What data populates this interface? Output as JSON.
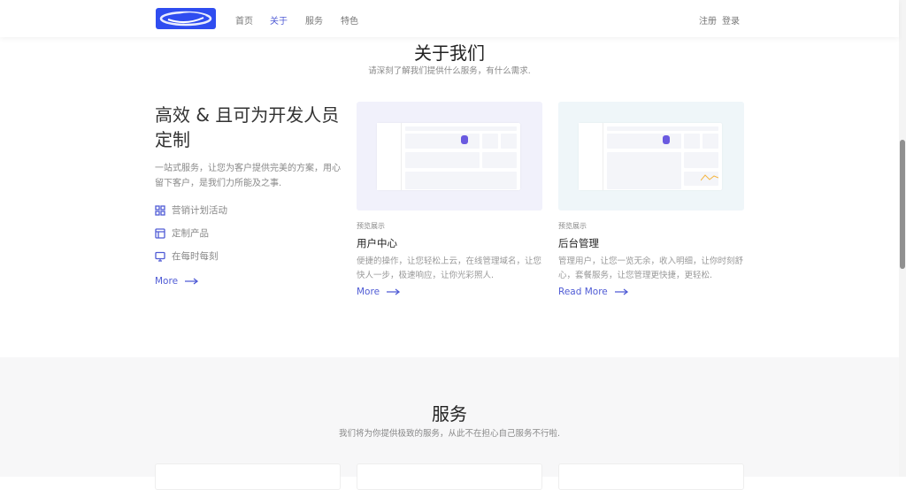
{
  "nav": {
    "items": [
      "首页",
      "关于",
      "服务",
      "特色"
    ],
    "active": 1,
    "register": "注册",
    "login": "登录"
  },
  "about": {
    "title": "关于我们",
    "subtitle": "请深刻了解我们提供什么服务，有什么需求.",
    "heading": "高效 & 且可为开发人员定制",
    "desc": "一站式服务，让您为客户提供完美的方案，用心留下客户，是我们力所能及之事.",
    "features": [
      {
        "icon": "grid-icon",
        "label": "营销计划活动"
      },
      {
        "icon": "layout-icon",
        "label": "定制产品"
      },
      {
        "icon": "monitor-icon",
        "label": "在每时每刻"
      }
    ],
    "more": "More",
    "cards": [
      {
        "tag": "预览展示",
        "title": "用户中心",
        "desc": "便捷的操作，让您轻松上云，在线管理域名，让您快人一步，极速响应，让你光彩照人.",
        "link": "More",
        "bg": "#f1f1fb"
      },
      {
        "tag": "预览展示",
        "title": "后台管理",
        "desc": "管理用户，让您一览无余，收入明细，让你时刻舒心，套餐服务，让您管理更快捷，更轻松.",
        "link": "Read More",
        "bg": "#eff6f9"
      }
    ]
  },
  "services": {
    "title": "服务",
    "subtitle": "我们将为你提供极致的服务，从此不在担心自己服务不行啦."
  },
  "colors": {
    "accent": "#4f5bd5",
    "logo": "#2f4df0"
  }
}
